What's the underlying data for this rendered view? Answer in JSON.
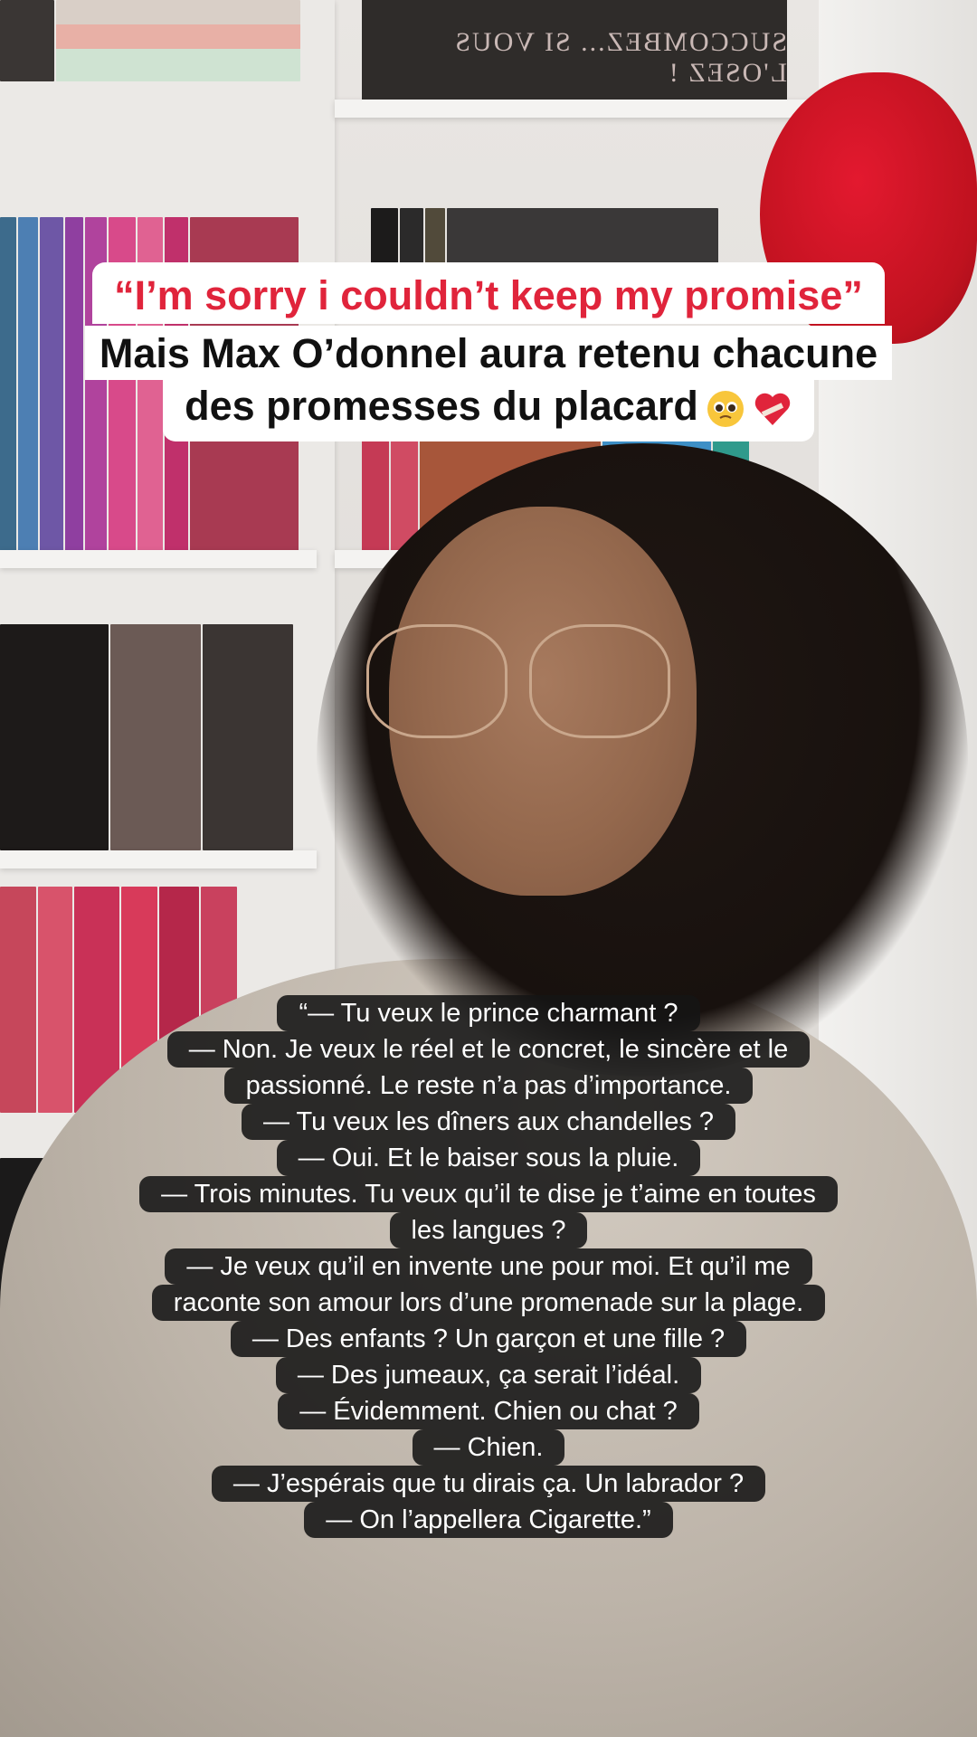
{
  "background": {
    "box_text": "SUCCOMBEZ... SI VOUS L'OSEZ !"
  },
  "caption_top": {
    "line1": "“I’m sorry i couldn’t keep my promise”",
    "line2": "Mais Max O’donnel aura retenu chacune",
    "line3": "des promesses du placard",
    "emojis": [
      "pleading-face-icon",
      "mending-heart-icon"
    ],
    "accent_color": "#e0243b"
  },
  "caption_quote": {
    "lines": [
      "“— Tu veux le prince charmant ?",
      "— Non. Je veux le réel et le concret, le sincère et le",
      "passionné. Le reste n’a pas d’importance.",
      "— Tu veux les dîners aux chandelles ?",
      "— Oui. Et le baiser sous la pluie.",
      "— Trois minutes. Tu veux qu’il te dise je t’aime en toutes",
      "les langues ?",
      "— Je veux qu’il en invente une pour moi. Et qu’il me",
      "raconte son amour lors d’une promenade sur la plage.",
      "— Des enfants ? Un garçon et une fille ?",
      "— Des jumeaux, ça serait l’idéal.",
      "— Évidemment. Chien ou chat ?",
      "— Chien.",
      "— J’espérais que tu dirais ça. Un labrador ?",
      "— On l’appellera Cigarette.”"
    ]
  }
}
